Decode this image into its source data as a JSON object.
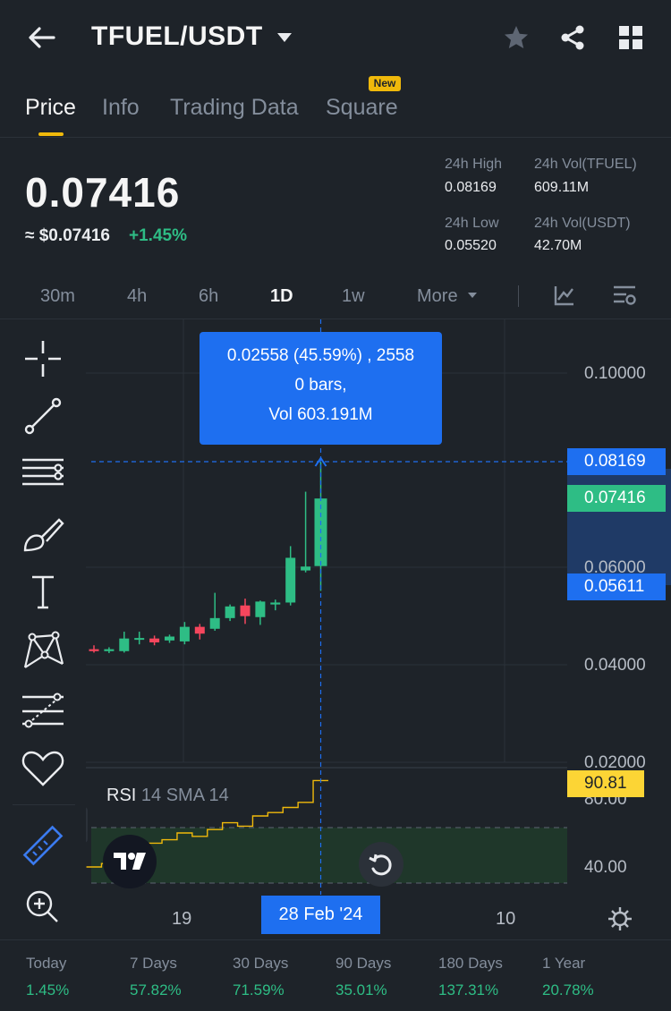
{
  "header": {
    "title": "TFUEL/USDT",
    "icons": [
      "back-arrow-icon",
      "caret-down-icon",
      "star-icon",
      "share-icon",
      "grid-icon"
    ]
  },
  "tabs": [
    {
      "label": "Price",
      "active": true
    },
    {
      "label": "Info",
      "active": false
    },
    {
      "label": "Trading Data",
      "active": false
    },
    {
      "label": "Square",
      "active": false
    }
  ],
  "new_badge": "New",
  "price": {
    "last": "0.07416",
    "usd": "≈ $0.07416",
    "change": "+1.45%"
  },
  "stats": {
    "high_label": "24h High",
    "high_value": "0.08169",
    "low_label": "24h Low",
    "low_value": "0.05520",
    "vol_base_label": "24h Vol(TFUEL)",
    "vol_base_value": "609.11M",
    "vol_quote_label": "24h Vol(USDT)",
    "vol_quote_value": "42.70M"
  },
  "intervals": [
    {
      "label": "30m",
      "active": false
    },
    {
      "label": "4h",
      "active": false
    },
    {
      "label": "6h",
      "active": false
    },
    {
      "label": "1D",
      "active": true
    },
    {
      "label": "1w",
      "active": false
    },
    {
      "label": "More",
      "active": false
    }
  ],
  "tools": [
    "crosshair-icon",
    "trend-line-icon",
    "horizontal-lines-icon",
    "brush-icon",
    "text-icon",
    "pattern-icon",
    "fib-icon",
    "favorite-icon",
    "ruler-icon",
    "zoom-icon"
  ],
  "tooltip": {
    "line1": "0.02558 (45.59%) , 2558",
    "line2": "0 bars,",
    "line3": "Vol 603.191M"
  },
  "price_tags": {
    "high": "0.08169",
    "last": "0.07416",
    "measure": "0.05611",
    "rsi": "90.81"
  },
  "date_label": "28 Feb '24",
  "rsi_label": "RSI",
  "rsi_params": "14 SMA 14",
  "colors": {
    "up": "#2ebd85",
    "down": "#f6465d",
    "accent": "#f0b90b",
    "blue": "#1e6ff0"
  },
  "chart_data": {
    "type": "candlestick",
    "y_axis_labels": [
      "0.10000",
      "0.06000",
      "0.04000",
      "0.02000"
    ],
    "rsi_axis_labels": [
      "80.00",
      "40.00"
    ],
    "x_axis_labels": [
      "19",
      "10"
    ],
    "candles": [
      {
        "o": 0.0432,
        "h": 0.044,
        "l": 0.0425,
        "c": 0.0428
      },
      {
        "o": 0.0428,
        "h": 0.0436,
        "l": 0.0424,
        "c": 0.0432
      },
      {
        "o": 0.0428,
        "h": 0.0468,
        "l": 0.0425,
        "c": 0.0454
      },
      {
        "o": 0.0452,
        "h": 0.0468,
        "l": 0.0442,
        "c": 0.0455
      },
      {
        "o": 0.0454,
        "h": 0.046,
        "l": 0.044,
        "c": 0.0446
      },
      {
        "o": 0.045,
        "h": 0.0462,
        "l": 0.0445,
        "c": 0.0458
      },
      {
        "o": 0.0448,
        "h": 0.0488,
        "l": 0.0442,
        "c": 0.0478
      },
      {
        "o": 0.0478,
        "h": 0.0484,
        "l": 0.0452,
        "c": 0.0464
      },
      {
        "o": 0.0474,
        "h": 0.0548,
        "l": 0.047,
        "c": 0.0496
      },
      {
        "o": 0.0496,
        "h": 0.0524,
        "l": 0.049,
        "c": 0.052
      },
      {
        "o": 0.0522,
        "h": 0.0536,
        "l": 0.0484,
        "c": 0.05
      },
      {
        "o": 0.0498,
        "h": 0.0532,
        "l": 0.0482,
        "c": 0.053
      },
      {
        "o": 0.0524,
        "h": 0.0534,
        "l": 0.0512,
        "c": 0.0528
      },
      {
        "o": 0.0528,
        "h": 0.0644,
        "l": 0.0522,
        "c": 0.062
      },
      {
        "o": 0.0594,
        "h": 0.0756,
        "l": 0.059,
        "c": 0.0602
      },
      {
        "o": 0.0603,
        "h": 0.0817,
        "l": 0.0552,
        "c": 0.0742
      }
    ],
    "rsi": [
      40,
      42,
      48,
      50,
      54,
      56,
      60,
      58,
      62,
      66,
      64,
      70,
      72,
      75,
      78,
      90.81
    ]
  },
  "performance": [
    {
      "label": "Today",
      "value": "1.45%"
    },
    {
      "label": "7 Days",
      "value": "57.82%"
    },
    {
      "label": "30 Days",
      "value": "71.59%"
    },
    {
      "label": "90 Days",
      "value": "35.01%"
    },
    {
      "label": "180 Days",
      "value": "137.31%"
    },
    {
      "label": "1 Year",
      "value": "20.78%"
    }
  ]
}
